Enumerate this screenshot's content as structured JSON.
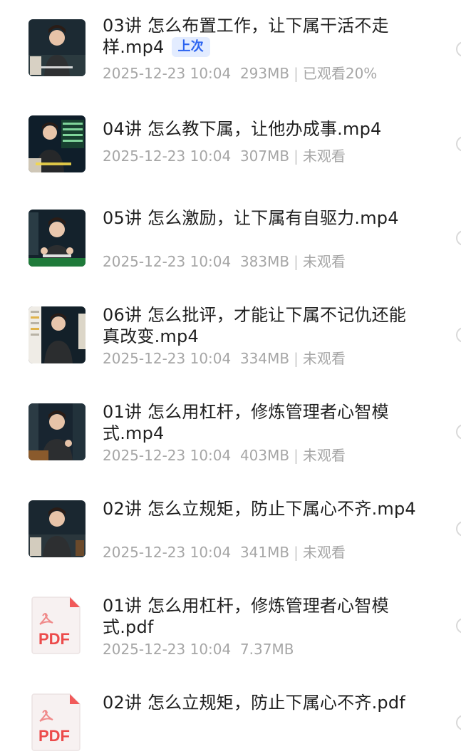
{
  "files": [
    {
      "title": "03讲 怎么布置工作，让下属干活不走样.mp4",
      "date": "2025-12-23 10:04",
      "size": "293MB",
      "status": "已观看20%",
      "badge": "上次"
    },
    {
      "title": "04讲 怎么教下属，让他办成事.mp4",
      "date": "2025-12-23 10:04",
      "size": "307MB",
      "status": "未观看"
    },
    {
      "title": "05讲 怎么激励，让下属有自驱力.mp4",
      "date": "2025-12-23 10:04",
      "size": "383MB",
      "status": "未观看"
    },
    {
      "title": "06讲 怎么批评，才能让下属不记仇还能真改变.mp4",
      "date": "2025-12-23 10:04",
      "size": "334MB",
      "status": "未观看"
    },
    {
      "title": "01讲 怎么用杠杆，修炼管理者心智模式.mp4",
      "date": "2025-12-23 10:04",
      "size": "403MB",
      "status": "未观看"
    },
    {
      "title": "02讲 怎么立规矩，防止下属心不齐.mp4",
      "date": "2025-12-23 10:04",
      "size": "341MB",
      "status": "未观看"
    },
    {
      "title": "01讲 怎么用杠杆，修炼管理者心智模式.pdf",
      "date": "2025-12-23 10:04",
      "size": "7.37MB"
    },
    {
      "title": "02讲 怎么立规矩，防止下属心不齐.pdf"
    }
  ],
  "pdf_label": "PDF",
  "separator": "|"
}
